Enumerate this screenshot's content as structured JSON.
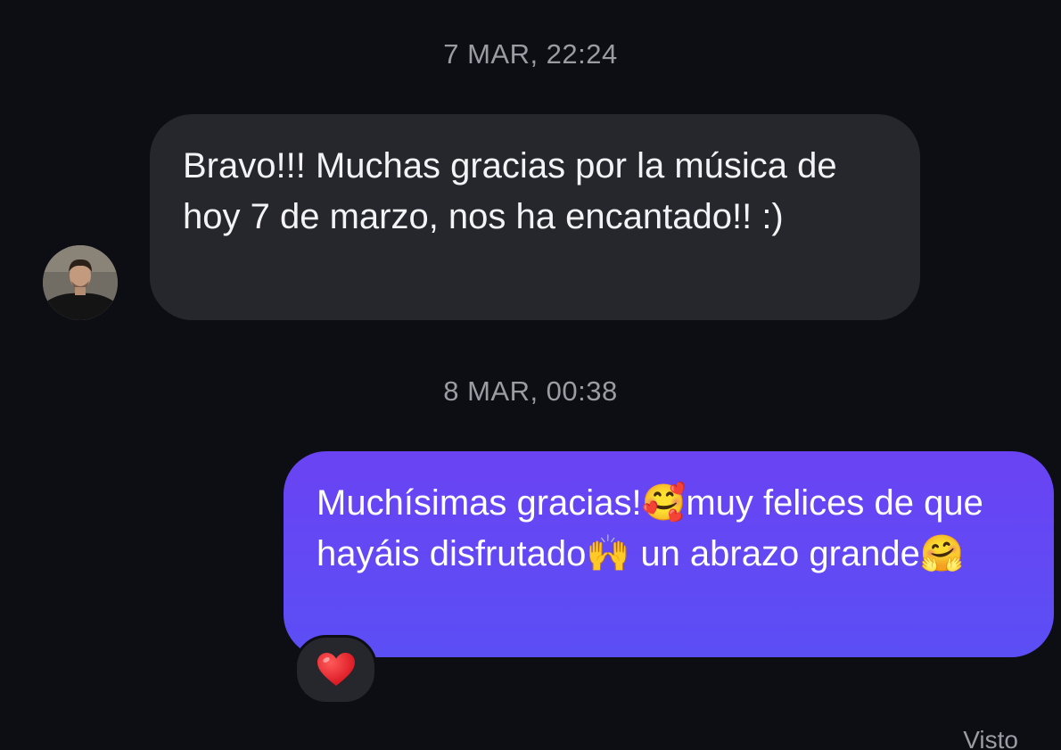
{
  "conversation": {
    "timestamp_1": "7 MAR, 22:24",
    "incoming_message": "Bravo!!! Muchas gracias por la música de hoy 7 de marzo, nos ha encantado!! :)",
    "timestamp_2": "8 MAR, 00:38",
    "outgoing_message": "Muchísimas gracias!🥰muy felices de que hayáis disfrutado🙌 un abrazo grande🤗",
    "reaction": "❤️",
    "seen_status": "Visto"
  },
  "colors": {
    "background": "#0c0e14",
    "incoming_bubble": "#25272c",
    "outgoing_bubble": "#5b4ef5",
    "timestamp_text": "#9a9ca3"
  },
  "icons": {
    "avatar": "contact-avatar-photo",
    "reaction": "heart-icon"
  }
}
